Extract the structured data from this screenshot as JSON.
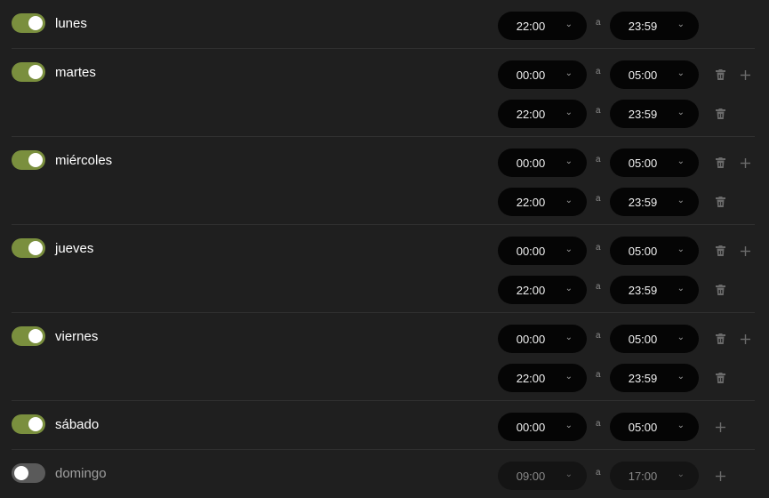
{
  "separator": "a",
  "days": [
    {
      "label": "lunes",
      "enabled": true,
      "slots": [
        {
          "start": "22:00",
          "end": "23:59",
          "trash": false,
          "plus": false
        }
      ]
    },
    {
      "label": "martes",
      "enabled": true,
      "slots": [
        {
          "start": "00:00",
          "end": "05:00",
          "trash": true,
          "plus": true
        },
        {
          "start": "22:00",
          "end": "23:59",
          "trash": true,
          "plus": false
        }
      ]
    },
    {
      "label": "miércoles",
      "enabled": true,
      "slots": [
        {
          "start": "00:00",
          "end": "05:00",
          "trash": true,
          "plus": true
        },
        {
          "start": "22:00",
          "end": "23:59",
          "trash": true,
          "plus": false
        }
      ]
    },
    {
      "label": "jueves",
      "enabled": true,
      "slots": [
        {
          "start": "00:00",
          "end": "05:00",
          "trash": true,
          "plus": true
        },
        {
          "start": "22:00",
          "end": "23:59",
          "trash": true,
          "plus": false
        }
      ]
    },
    {
      "label": "viernes",
      "enabled": true,
      "slots": [
        {
          "start": "00:00",
          "end": "05:00",
          "trash": true,
          "plus": true
        },
        {
          "start": "22:00",
          "end": "23:59",
          "trash": true,
          "plus": false
        }
      ]
    },
    {
      "label": "sábado",
      "enabled": true,
      "slots": [
        {
          "start": "00:00",
          "end": "05:00",
          "trash": false,
          "plus": true
        }
      ]
    },
    {
      "label": "domingo",
      "enabled": false,
      "slots": [
        {
          "start": "09:00",
          "end": "17:00",
          "trash": false,
          "plus": true
        }
      ]
    }
  ],
  "icons": {
    "toggle": "toggle-switch",
    "trash": "trash-icon",
    "plus": "plus-icon",
    "chevron": "chevron-down-icon"
  },
  "colors": {
    "background": "#1f1f1f",
    "toggle_on": "#7a8f3e",
    "toggle_off": "#5a5a5a",
    "select_bg": "#050505"
  }
}
